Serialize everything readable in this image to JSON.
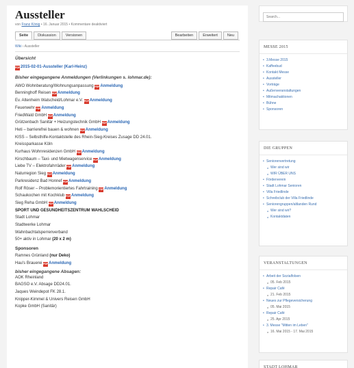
{
  "article": {
    "title": "Aussteller",
    "meta_prefix": "von",
    "meta_author": "Franz König",
    "meta_rest": "• 16. Januar 2015 • Kommentare deaktiviert",
    "tabs": [
      "Seite",
      "Diskussion",
      "Versionen"
    ],
    "actions": [
      "Bearbeiten",
      "Erweitert",
      "Neu"
    ],
    "crumb_home": "Wiki",
    "crumb_sep": " › ",
    "crumb_current": "Aussteller",
    "overview_heading": "Übersicht",
    "overview_link": "2015-02-01-Aussteller (Karl-Heinz)",
    "prev_heading": "Bisher eingegangene Anmeldungen (Verlinkungen s. lohmar.de):",
    "anmeldung": "Anmeldung",
    "entries": [
      {
        "text": "AWO Wohnberatung/Wohnungsanpassung",
        "link": true
      },
      {
        "text": "Benninghoff Reisen",
        "link": true
      },
      {
        "text": "Ev. Altenheim Walscheid/Lohmar e.V.",
        "link": true
      },
      {
        "text": "Feuerwehr",
        "link": true
      },
      {
        "text": "FriedWald GmbH",
        "link": true
      },
      {
        "text": "Grützenbach Sanitär + Heizungstechnik GmbH",
        "link": true
      },
      {
        "text": "Heti – barrierefrei bauen & wohnen",
        "link": true
      },
      {
        "text": "KISS – Selbsthilfe-Kontaktstelle des Rhein-Sieg-Kreises     Zusage DD 24.01.",
        "link": false
      },
      {
        "text": "Kreissparkasse Köln",
        "link": false
      },
      {
        "text": "Kurhaus Wohnresidenzen GmbH",
        "link": true
      },
      {
        "text": "Kirschbaum – Taxi- und Mietwagenservice",
        "link": true
      },
      {
        "text": "Liebe TV – Elektrofahrräder",
        "link": true
      },
      {
        "text": "Naturregion Sieg",
        "link": true
      },
      {
        "text": "Parkresidenz Bad Honnef",
        "link": true
      },
      {
        "text": "Rolf Röser – Problemorientiertes Fahrtraining",
        "link": true
      },
      {
        "text": "Schaukochen mit Kochklub",
        "link": true
      },
      {
        "text": "Sieg Reha GmbH",
        "link": true
      }
    ],
    "entries_plain": [
      {
        "text": "SPORT UND GESUNDHEITSZENTRUM WAHLSCHEID",
        "bold": true
      },
      {
        "text": "Stadt Lohmar",
        "bold": false
      },
      {
        "text": "Stadtwerke Lohmar",
        "bold": false
      },
      {
        "text": "Wahnbachtalsperrenverband",
        "bold": false
      },
      {
        "text": "50+ aktiv in Lohmar ",
        "bold": false,
        "suffix": "(20 x 2 m)"
      }
    ],
    "sponsors_heading": "Sponsoren",
    "sponsor1_text": "Ramnes Grünland ",
    "sponsor1_suffix": "(nur Deko)",
    "sponsor2_text": "Hau's Brauerei",
    "cancel_heading": "bisher eingegangene Absagen:",
    "cancellations": [
      "AOK Rheinland",
      "BAGSO e.V. Absage DD24.01.",
      "Jaques Weindepot FK 28.1.",
      "Knipper-Kimmel & Univers Reisen GmbH",
      "Kopke GmbH (Sanitär)"
    ]
  },
  "sidebar": {
    "search_placeholder": "Search...",
    "messe": {
      "title": "MESSE 2015",
      "items": [
        "3.Messe 2015",
        "Kaffeebud",
        "Kontakt Messe",
        "Aussteller",
        "Vorträge",
        "Außenveranstaltungen",
        "Mitmachaktionen",
        "Bühne",
        "Sponsoren"
      ]
    },
    "gruppen": {
      "title": "DIE GRUPPEN",
      "items": [
        {
          "t": "Seniorenvertretung",
          "k": "top"
        },
        {
          "t": "Wer sind wir",
          "k": "sub"
        },
        {
          "t": "WIR ÜBER UNS",
          "k": "sub"
        },
        {
          "t": "Förderverein",
          "k": "top"
        },
        {
          "t": "Stadt Lohmar Senioren",
          "k": "top"
        },
        {
          "t": "Villa Friedlinde",
          "k": "top"
        },
        {
          "t": "Schreibclub der Villa Friedlinde",
          "k": "top"
        },
        {
          "t": "Seniorengruppen/altlanden Rund",
          "k": "top"
        },
        {
          "t": "Wer sind wir?",
          "k": "sub"
        },
        {
          "t": "Kontaktdaten",
          "k": "sub"
        }
      ]
    },
    "veranst": {
      "title": "VERANSTALTUNGEN",
      "items": [
        {
          "t": "Arbeit der Sozialfolsen",
          "k": "top"
        },
        {
          "t": "05. Feb 2015",
          "k": "date"
        },
        {
          "t": "Repair Café",
          "k": "top"
        },
        {
          "t": "21. Feb 2015",
          "k": "date"
        },
        {
          "t": "Neues zur Pflegeversicherung",
          "k": "top"
        },
        {
          "t": "05. Mai 2015",
          "k": "date"
        },
        {
          "t": "Repair Café",
          "k": "top"
        },
        {
          "t": "25. Apr 2015",
          "k": "date"
        },
        {
          "t": "3. Messe \"Mitten im Leben\"",
          "k": "top"
        },
        {
          "t": "16. Mai 2015 - 17. Mai 2015",
          "k": "date"
        }
      ]
    },
    "stadt": {
      "title": "STADT LOHMAR"
    }
  }
}
